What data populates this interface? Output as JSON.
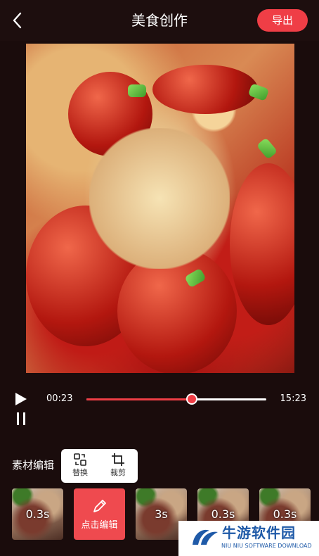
{
  "header": {
    "title": "美食创作",
    "export_label": "导出"
  },
  "player": {
    "current_time": "00:23",
    "total_time": "15:23",
    "progress": 0.585
  },
  "material": {
    "label": "素材编辑",
    "menu": [
      {
        "label": "替换",
        "icon": "replace-icon"
      },
      {
        "label": "裁剪",
        "icon": "crop-icon"
      }
    ]
  },
  "clips": [
    {
      "duration": "0.3s"
    },
    {
      "edit_label": "点击编辑"
    },
    {
      "duration": "3s"
    },
    {
      "duration": "0.3s"
    },
    {
      "duration": "0.3s"
    }
  ],
  "watermark": {
    "title": "牛游软件园",
    "subtitle": "NIU NIU SOFTWARE DOWNLOAD"
  },
  "colors": {
    "accent": "#ef3e46",
    "background": "#1a0c0c"
  }
}
